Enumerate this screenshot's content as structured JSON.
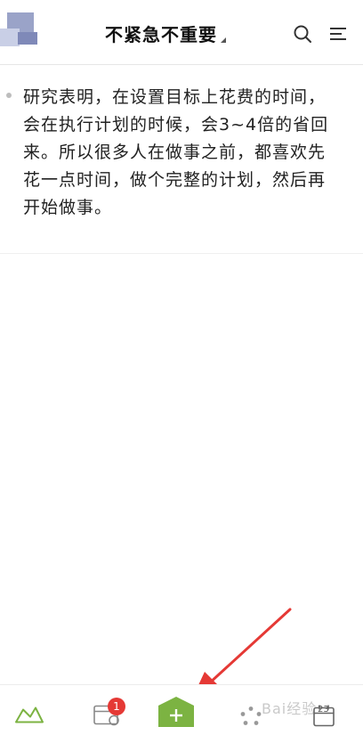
{
  "header": {
    "title": "不紧急不重要"
  },
  "note": {
    "text": "研究表明，在设置目标上花费的时间，会在执行计划的时候，会3~4倍的省回来。所以很多人在做事之前，都喜欢先花一点时间，做个完整的计划，然后再开始做事。"
  },
  "tabbar": {
    "calendar_badge": "1",
    "date_label": "23"
  },
  "watermark": "Bai经验",
  "colors": {
    "accent_green": "#7cb342",
    "badge_red": "#e53935",
    "arrow_red": "#e53935"
  }
}
